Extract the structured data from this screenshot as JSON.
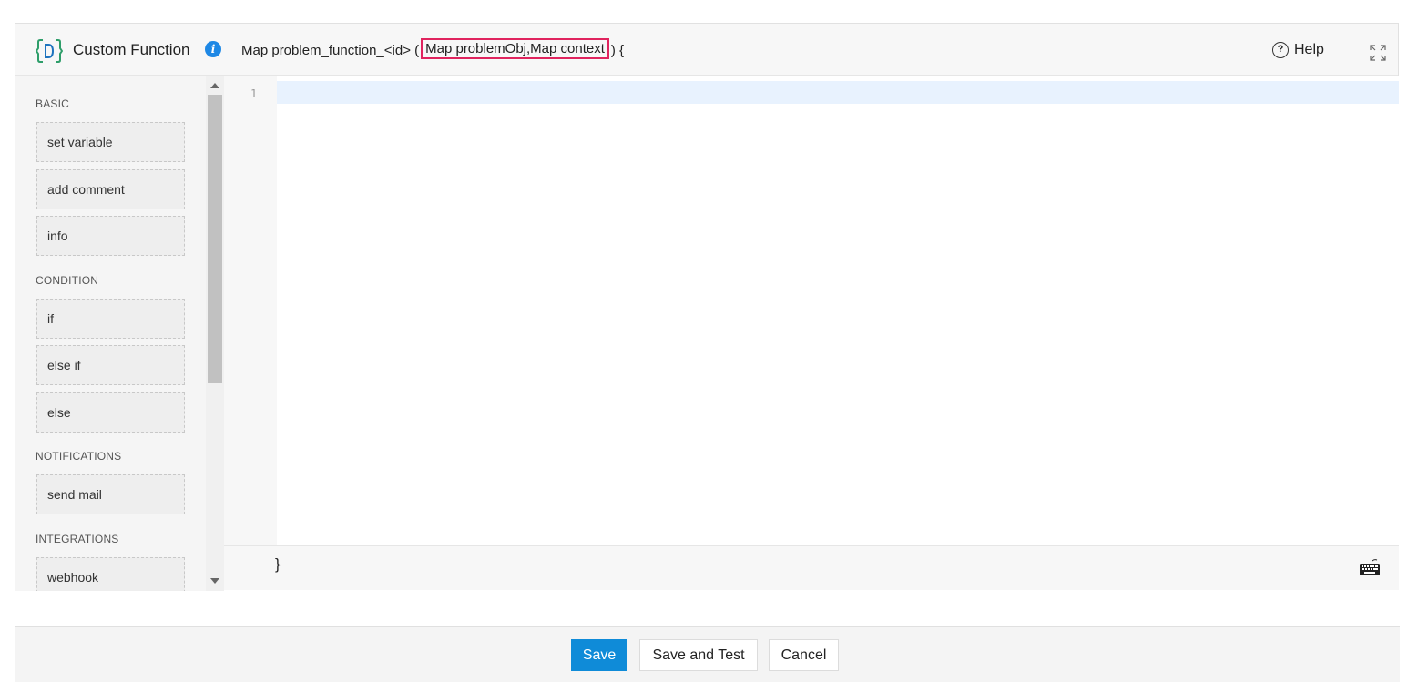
{
  "header": {
    "title": "Custom Function",
    "signature_prefix": "Map problem_function_<id> (",
    "signature_params": "Map problemObj,Map context",
    "signature_suffix": ") {",
    "help_label": "Help"
  },
  "sidebar": {
    "categories": [
      {
        "label": "BASIC",
        "items": [
          "set variable",
          "add comment",
          "info"
        ]
      },
      {
        "label": "CONDITION",
        "items": [
          "if",
          "else if",
          "else"
        ]
      },
      {
        "label": "NOTIFICATIONS",
        "items": [
          "send mail"
        ]
      },
      {
        "label": "INTEGRATIONS",
        "items": [
          "webhook"
        ]
      }
    ]
  },
  "editor": {
    "line_numbers": [
      "1"
    ],
    "closing_brace": "}"
  },
  "actions": {
    "save_label": "Save",
    "save_test_label": "Save and Test",
    "cancel_label": "Cancel"
  },
  "colors": {
    "accent": "#0f8bd8",
    "highlight_border": "#e0245e",
    "info_icon": "#1e88e5",
    "active_line": "#e8f2fe"
  },
  "icons": [
    "custom-function-icon",
    "info-icon",
    "help-icon",
    "expand-icon",
    "keyboard-icon",
    "scroll-up-icon",
    "scroll-down-icon"
  ]
}
